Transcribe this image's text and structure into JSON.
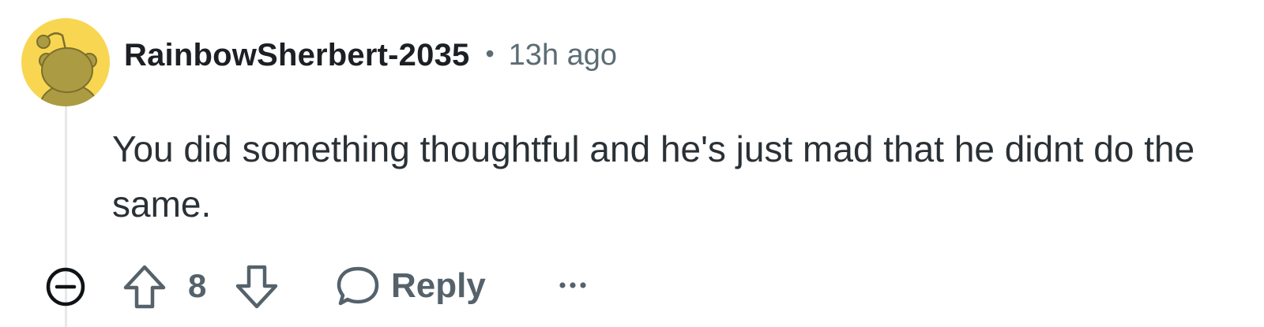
{
  "comment": {
    "username": "RainbowSherbert-2035",
    "separator": "•",
    "timestamp": "13h ago",
    "text": "You did something thoughtful and he's just mad that he didnt do the same.",
    "avatar": {
      "icon": "snoo-avatar-icon",
      "background_color": "#f8d652",
      "figure_color": "#ab9b43"
    }
  },
  "actions": {
    "collapse_icon": "collapse-minus-icon",
    "upvote_icon": "upvote-arrow-icon",
    "vote_count": "8",
    "downvote_icon": "downvote-arrow-icon",
    "reply_icon": "speech-bubble-icon",
    "reply_label": "Reply",
    "more_icon": "ellipsis-icon"
  },
  "colors": {
    "text_primary": "#1c2024",
    "text_secondary": "#5c6c74",
    "thread_line": "#e6e8ea"
  }
}
